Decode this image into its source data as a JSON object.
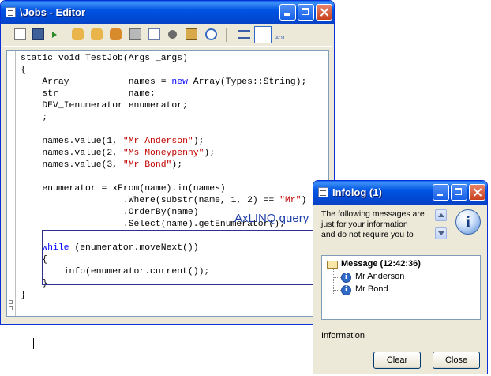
{
  "editor": {
    "title": "\\Jobs - Editor",
    "toolbar_icons": [
      "new-icon",
      "save-icon",
      "run-icon",
      "hand-icon",
      "hand2-icon",
      "hand3-icon",
      "compile-icon",
      "copy-icon",
      "find-icon",
      "lookup-icon",
      "help-icon",
      "list-icon",
      "properties-icon",
      "aot-icon"
    ],
    "aot_label": "AOT",
    "annotation": "AxLINQ query",
    "code_lines": [
      [
        {
          "t": "static void TestJob(Args _args)"
        }
      ],
      [
        {
          "t": "{"
        }
      ],
      [
        {
          "t": "    Array           names = "
        },
        {
          "t": "new",
          "k": "kw"
        },
        {
          "t": " Array(Types::String);"
        }
      ],
      [
        {
          "t": "    str             name;"
        }
      ],
      [
        {
          "t": "    DEV_Ienumerator enumerator;"
        }
      ],
      [
        {
          "t": "    ;"
        }
      ],
      [
        {
          "t": ""
        }
      ],
      [
        {
          "t": "    names.value(1, "
        },
        {
          "t": "\"Mr Anderson\"",
          "k": "str"
        },
        {
          "t": ");"
        }
      ],
      [
        {
          "t": "    names.value(2, "
        },
        {
          "t": "\"Ms Moneypenny\"",
          "k": "str"
        },
        {
          "t": ");"
        }
      ],
      [
        {
          "t": "    names.value(3, "
        },
        {
          "t": "\"Mr Bond\"",
          "k": "str"
        },
        {
          "t": ");"
        }
      ],
      [
        {
          "t": ""
        }
      ],
      [
        {
          "t": "    enumerator = xFrom(name).in(names)"
        }
      ],
      [
        {
          "t": "                   .Where(substr(name, 1, 2) == "
        },
        {
          "t": "\"Mr\"",
          "k": "str"
        },
        {
          "t": ")"
        }
      ],
      [
        {
          "t": "                   .OrderBy(name)"
        }
      ],
      [
        {
          "t": "                   .Select(name).getEnumerator();"
        }
      ],
      [
        {
          "t": ""
        }
      ],
      [
        {
          "t": "    "
        },
        {
          "t": "while",
          "k": "kw"
        },
        {
          "t": " (enumerator.moveNext())"
        }
      ],
      [
        {
          "t": "    {"
        }
      ],
      [
        {
          "t": "        info(enumerator.current());"
        }
      ],
      [
        {
          "t": "    }"
        }
      ],
      [
        {
          "t": "}"
        }
      ]
    ]
  },
  "infolog": {
    "title": "Infolog (1)",
    "message_text": [
      "The following messages are",
      "just for your information",
      "and do not require you to"
    ],
    "tree_root": "Message (12:42:36)",
    "tree_items": [
      "Mr Anderson",
      "Mr Bond"
    ],
    "status": "Information",
    "clear_label": "Clear",
    "close_label": "Close"
  },
  "colors": {
    "keyword": "#0000ff",
    "string": "#c00000",
    "titlebar": "#0054e3",
    "annotation": "#1f3fa8"
  }
}
